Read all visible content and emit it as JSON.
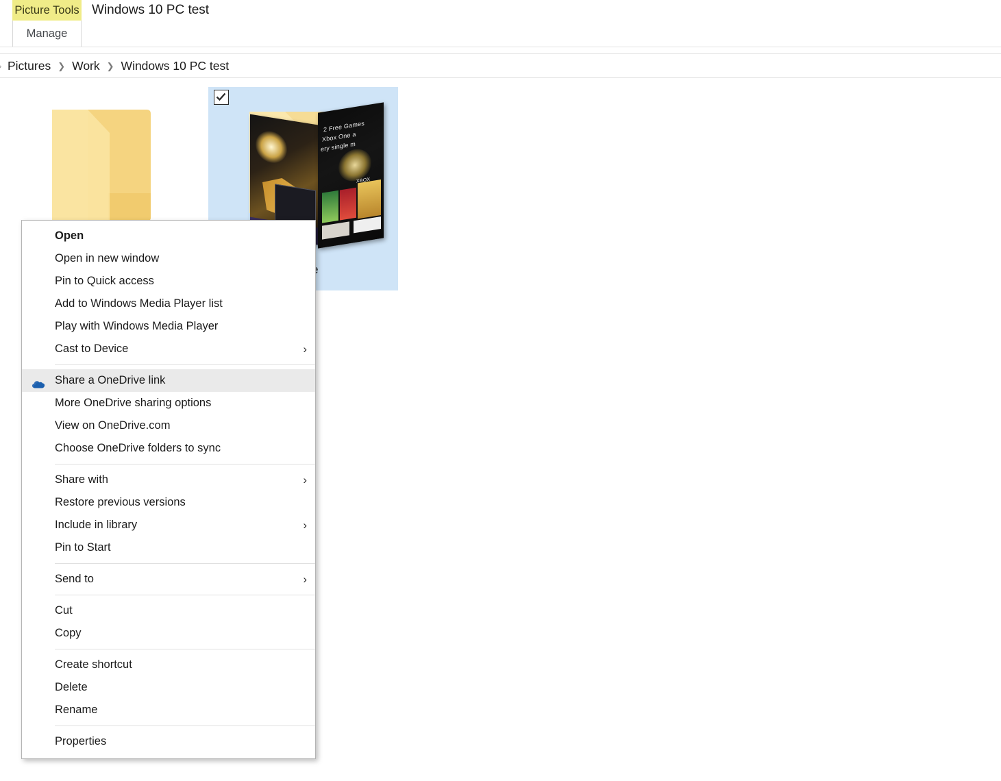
{
  "ribbon": {
    "contextual_tab_group_label": "Picture Tools",
    "contextual_tab_label": "Manage",
    "window_title": "Windows 10 PC test",
    "highlight_color": "#f0ec88"
  },
  "breadcrumb": {
    "back_glyph": "›",
    "separator_glyph": "❯",
    "crumbs": [
      {
        "label": "Pictures"
      },
      {
        "label": "Work"
      },
      {
        "label": "Windows 10 PC test"
      }
    ]
  },
  "file_view": {
    "selection_color": "#cfe4f7",
    "folder_color": "#f2d27f",
    "items": [
      {
        "name": "folder-plain",
        "icon": "folder-icon",
        "label": "",
        "selected": false,
        "checkbox_visible": false
      },
      {
        "name": "folder-with-pictures",
        "icon": "folder-with-thumbnail-icon",
        "label": "Share",
        "selected": true,
        "checkbox_visible": true,
        "checkbox_checked": true,
        "thumbnail_text": [
          "2 Free Games",
          "Xbox One a",
          "ery single m",
          "XBOX"
        ]
      }
    ]
  },
  "context_menu": {
    "highlight_color": "#eaeaea",
    "submenu_arrow_glyph": "›",
    "groups": [
      {
        "items": [
          {
            "label": "Open",
            "bold": true,
            "submenu": false,
            "icon": null,
            "highlighted": false
          },
          {
            "label": "Open in new window",
            "bold": false,
            "submenu": false,
            "icon": null,
            "highlighted": false
          },
          {
            "label": "Pin to Quick access",
            "bold": false,
            "submenu": false,
            "icon": null,
            "highlighted": false
          },
          {
            "label": "Add to Windows Media Player list",
            "bold": false,
            "submenu": false,
            "icon": null,
            "highlighted": false
          },
          {
            "label": "Play with Windows Media Player",
            "bold": false,
            "submenu": false,
            "icon": null,
            "highlighted": false
          },
          {
            "label": "Cast to Device",
            "bold": false,
            "submenu": true,
            "icon": null,
            "highlighted": false
          }
        ]
      },
      {
        "items": [
          {
            "label": "Share a OneDrive link",
            "bold": false,
            "submenu": false,
            "icon": "onedrive-cloud-icon",
            "highlighted": true
          },
          {
            "label": "More OneDrive sharing options",
            "bold": false,
            "submenu": false,
            "icon": null,
            "highlighted": false
          },
          {
            "label": "View on OneDrive.com",
            "bold": false,
            "submenu": false,
            "icon": null,
            "highlighted": false
          },
          {
            "label": "Choose OneDrive folders to sync",
            "bold": false,
            "submenu": false,
            "icon": null,
            "highlighted": false
          }
        ]
      },
      {
        "items": [
          {
            "label": "Share with",
            "bold": false,
            "submenu": true,
            "icon": null,
            "highlighted": false
          },
          {
            "label": "Restore previous versions",
            "bold": false,
            "submenu": false,
            "icon": null,
            "highlighted": false
          },
          {
            "label": "Include in library",
            "bold": false,
            "submenu": true,
            "icon": null,
            "highlighted": false
          },
          {
            "label": "Pin to Start",
            "bold": false,
            "submenu": false,
            "icon": null,
            "highlighted": false
          }
        ]
      },
      {
        "items": [
          {
            "label": "Send to",
            "bold": false,
            "submenu": true,
            "icon": null,
            "highlighted": false
          }
        ]
      },
      {
        "items": [
          {
            "label": "Cut",
            "bold": false,
            "submenu": false,
            "icon": null,
            "highlighted": false
          },
          {
            "label": "Copy",
            "bold": false,
            "submenu": false,
            "icon": null,
            "highlighted": false
          }
        ]
      },
      {
        "items": [
          {
            "label": "Create shortcut",
            "bold": false,
            "submenu": false,
            "icon": null,
            "highlighted": false
          },
          {
            "label": "Delete",
            "bold": false,
            "submenu": false,
            "icon": null,
            "highlighted": false
          },
          {
            "label": "Rename",
            "bold": false,
            "submenu": false,
            "icon": null,
            "highlighted": false
          }
        ]
      },
      {
        "items": [
          {
            "label": "Properties",
            "bold": false,
            "submenu": false,
            "icon": null,
            "highlighted": false
          }
        ]
      }
    ]
  }
}
